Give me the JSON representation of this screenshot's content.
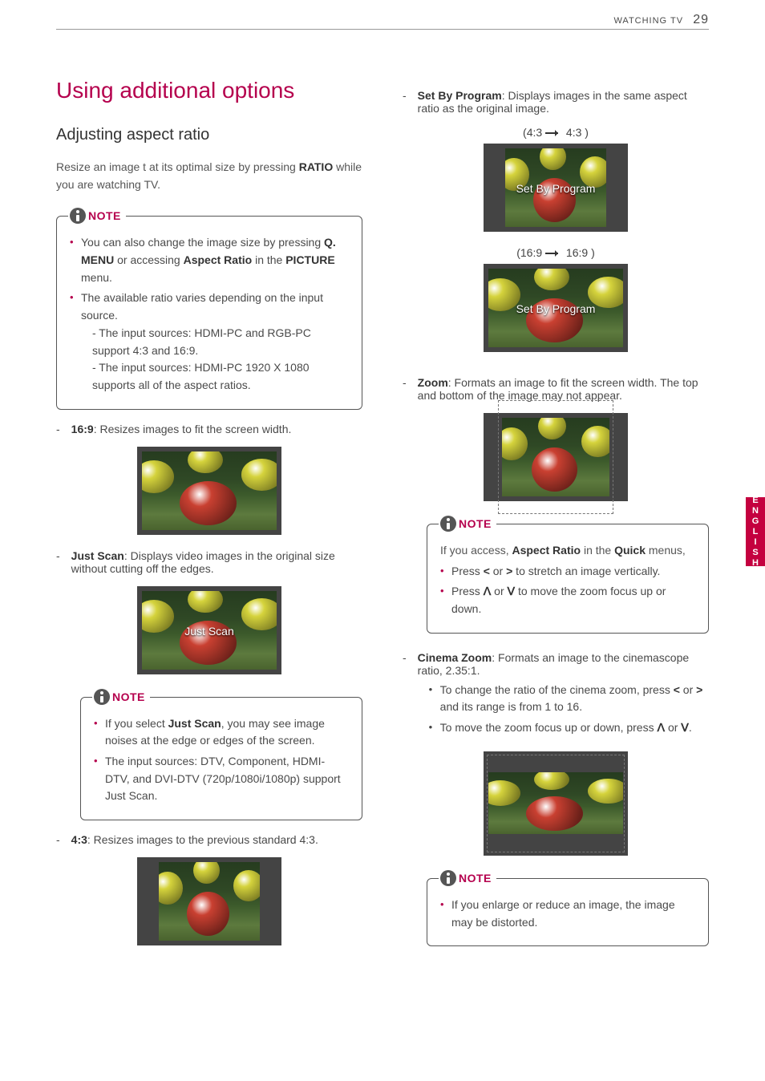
{
  "header": {
    "section": "WATCHING TV",
    "page": "29"
  },
  "sideTab": "ENGLISH",
  "title": "Using additional options",
  "subtitle": "Adjusting aspect ratio",
  "intro": {
    "pre": "Resize an image t at its optimal size by pressing ",
    "bold": "RATIO",
    "post": " while you are watching TV."
  },
  "note1": {
    "label": "NOTE",
    "b1a": "You can also change the image size by pressing ",
    "b1b": "Q. MENU",
    "b1c": " or accessing ",
    "b1d": "Aspect Ratio",
    "b1e": " in the ",
    "b1f": "PICTURE",
    "b1g": " menu.",
    "b2": "The available ratio varies depending on the input source.",
    "b2s1": "- The input sources: HDMI-PC and RGB-PC support 4:3 and 16:9.",
    "b2s2": "- The input sources: HDMI-PC 1920 X 1080 supports all of the aspect ratios."
  },
  "r169": {
    "name": "16:9",
    "desc": ": Resizes images to fit the screen width."
  },
  "justScan": {
    "name": "Just Scan",
    "desc": ": Displays video images in the original size without cutting off the edges.",
    "overlay": "Just Scan"
  },
  "note2": {
    "label": "NOTE",
    "b1a": "If you select ",
    "b1b": "Just Scan",
    "b1c": ", you may see image noises at the edge or edges of the screen.",
    "b2": "The input sources: DTV, Component, HDMI-DTV, and DVI-DTV (720p/1080i/1080p) support Just Scan."
  },
  "r43": {
    "name": "4:3",
    "desc": ": Resizes images to the previous standard 4:3."
  },
  "setByProgram": {
    "name": "Set By Program",
    "desc": ": Displays images in the same aspect ratio as the original image.",
    "line1a": "(4:3 ",
    "line1b": " 4:3 )",
    "line2a": "(16:9 ",
    "line2b": " 16:9 )",
    "overlay1": "Set By Program",
    "overlay2": "Set By Program"
  },
  "zoom": {
    "name": "Zoom",
    "desc": ": Formats an image to fit the screen width. The top and bottom of the image may not appear."
  },
  "note3": {
    "label": "NOTE",
    "intro1": "If you access, ",
    "intro2": "Aspect Ratio",
    "intro3": " in the ",
    "intro4": "Quick",
    "intro5": " menus,",
    "b1a": "Press ",
    "b1b": "<",
    "b1c": " or ",
    "b1d": ">",
    "b1e": " to stretch an image vertically.",
    "b2a": "Press ",
    "b2b": "ꓥ",
    "b2c": " or ",
    "b2d": "ꓦ",
    "b2e": " to move the zoom focus up or down."
  },
  "cinema": {
    "name": "Cinema Zoom",
    "desc": ": Formats an image to the cinemascope ratio, 2.35:1.",
    "s1a": "To change the ratio of the cinema zoom, press ",
    "s1b": "<",
    "s1c": " or ",
    "s1d": ">",
    "s1e": " and its range is from 1 to 16.",
    "s2a": "To move the zoom focus up or down, press ",
    "s2b": "ꓥ",
    "s2c": " or ",
    "s2d": "ꓦ",
    "s2e": "."
  },
  "note4": {
    "label": "NOTE",
    "b1": "If you enlarge or reduce an image, the image may be distorted."
  }
}
